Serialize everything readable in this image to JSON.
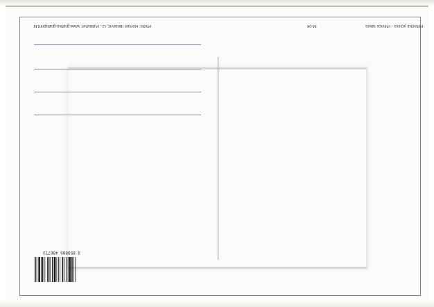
{
  "postcard": {
    "caption": "Plitvička jezera - Plitvice lakes",
    "code": "M-04",
    "credit": "Photo: Romeo Ibrišević, O., Publisher: www.grafika-grafoprint.hr",
    "barcode_number": "3 859886 486773",
    "address_lines": 4,
    "colors": {
      "frame": "#7e8083",
      "address_line": "#7d7f96",
      "paper": "#fbfbf9"
    }
  }
}
